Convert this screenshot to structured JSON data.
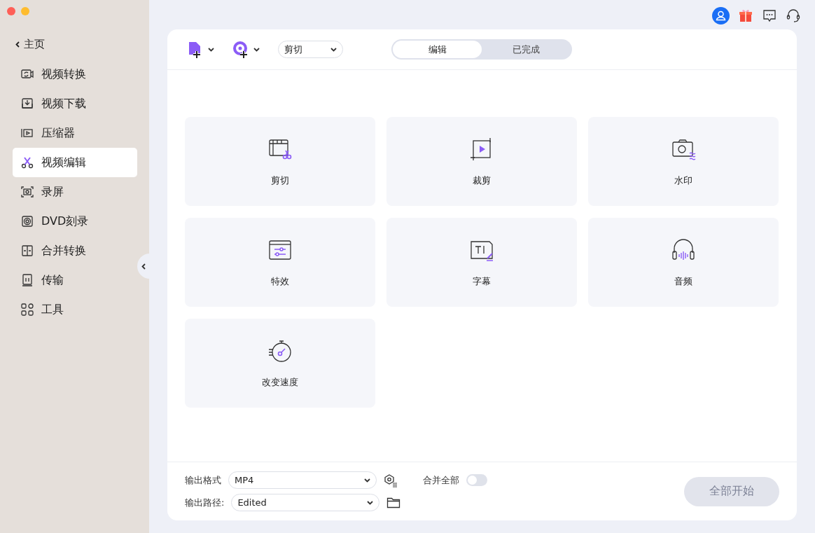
{
  "sidebar": {
    "back": {
      "label": "主页"
    },
    "items": [
      {
        "label": "视频转换",
        "kind": "convert",
        "selected": false
      },
      {
        "label": "视频下载",
        "kind": "download",
        "selected": false
      },
      {
        "label": "压缩器",
        "kind": "compress",
        "selected": false
      },
      {
        "label": "视频编辑",
        "kind": "edit",
        "selected": true
      },
      {
        "label": "录屏",
        "kind": "record",
        "selected": false
      },
      {
        "label": "DVD刻录",
        "kind": "dvd",
        "selected": false
      },
      {
        "label": "合并转换",
        "kind": "merge",
        "selected": false
      },
      {
        "label": "传输",
        "kind": "transfer",
        "selected": false
      },
      {
        "label": "工具",
        "kind": "tools",
        "selected": false
      }
    ]
  },
  "toolbar": {
    "dropdown": {
      "value": "剪切"
    },
    "tabs": [
      {
        "label": "编辑",
        "selected": true
      },
      {
        "label": "已完成",
        "selected": false
      }
    ]
  },
  "tools": [
    {
      "label": "剪切",
      "kind": "trim"
    },
    {
      "label": "裁剪",
      "kind": "crop"
    },
    {
      "label": "水印",
      "kind": "watermark"
    },
    {
      "label": "特效",
      "kind": "effects"
    },
    {
      "label": "字幕",
      "kind": "subtitle"
    },
    {
      "label": "音频",
      "kind": "audio"
    },
    {
      "label": "改变速度",
      "kind": "speed"
    }
  ],
  "footer": {
    "format_label": "输出格式",
    "format_value": "MP4",
    "merge_label": "合并全部",
    "merge_on": false,
    "path_label": "输出路径:",
    "path_value": "Edited",
    "start": {
      "label": "全部开始",
      "disabled": true
    }
  }
}
